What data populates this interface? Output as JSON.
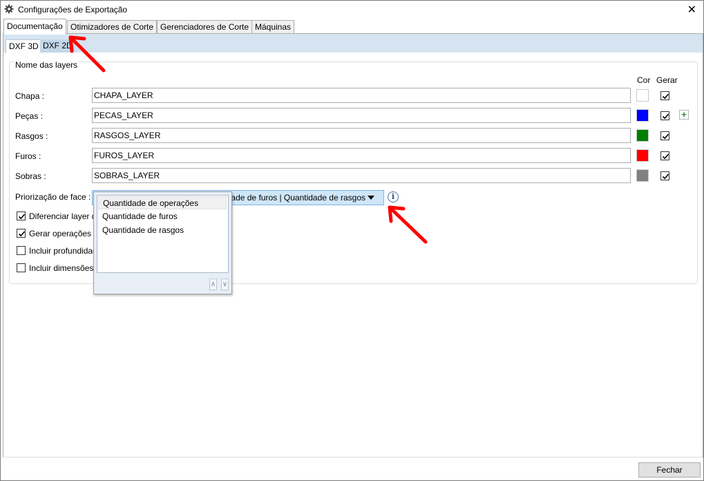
{
  "window": {
    "title": "Configurações de Exportação",
    "close_glyph": "✕"
  },
  "tabs": [
    "Documentação",
    "Otimizadores de Corte",
    "Gerenciadores de Corte",
    "Máquinas"
  ],
  "subtabs": [
    "DXF 3D",
    "DXF 2D"
  ],
  "group": {
    "title": "Nome das layers",
    "col_cor": "Cor",
    "col_gerar": "Gerar",
    "rows": [
      {
        "label": "Chapa :",
        "value": "CHAPA_LAYER",
        "color": "#ffffff",
        "gerar": true
      },
      {
        "label": "Peças :",
        "value": "PECAS_LAYER",
        "color": "#0000ff",
        "gerar": true
      },
      {
        "label": "Rasgos :",
        "value": "RASGOS_LAYER",
        "color": "#008000",
        "gerar": true
      },
      {
        "label": "Furos :",
        "value": "FUROS_LAYER",
        "color": "#ff0000",
        "gerar": true
      },
      {
        "label": "Sobras :",
        "value": "SOBRAS_LAYER",
        "color": "#808080",
        "gerar": true
      }
    ],
    "priorizacao_label": "Priorização de face :",
    "priorizacao_value": "Quantidade de operações | Quantidade de furos | Quantidade de rasgos",
    "checkboxes": [
      {
        "label": "Diferenciar layer de",
        "checked": true
      },
      {
        "label": "Gerar operações de",
        "checked": true
      },
      {
        "label": "Incluir profundidade",
        "checked": false
      },
      {
        "label": "Incluir dimensões",
        "checked": false
      }
    ]
  },
  "dropdown": {
    "options": [
      "Quantidade de operações",
      "Quantidade de furos",
      "Quantidade de rasgos"
    ],
    "up_glyph": "∧",
    "down_glyph": "∨"
  },
  "footer": {
    "close_label": "Fechar"
  }
}
